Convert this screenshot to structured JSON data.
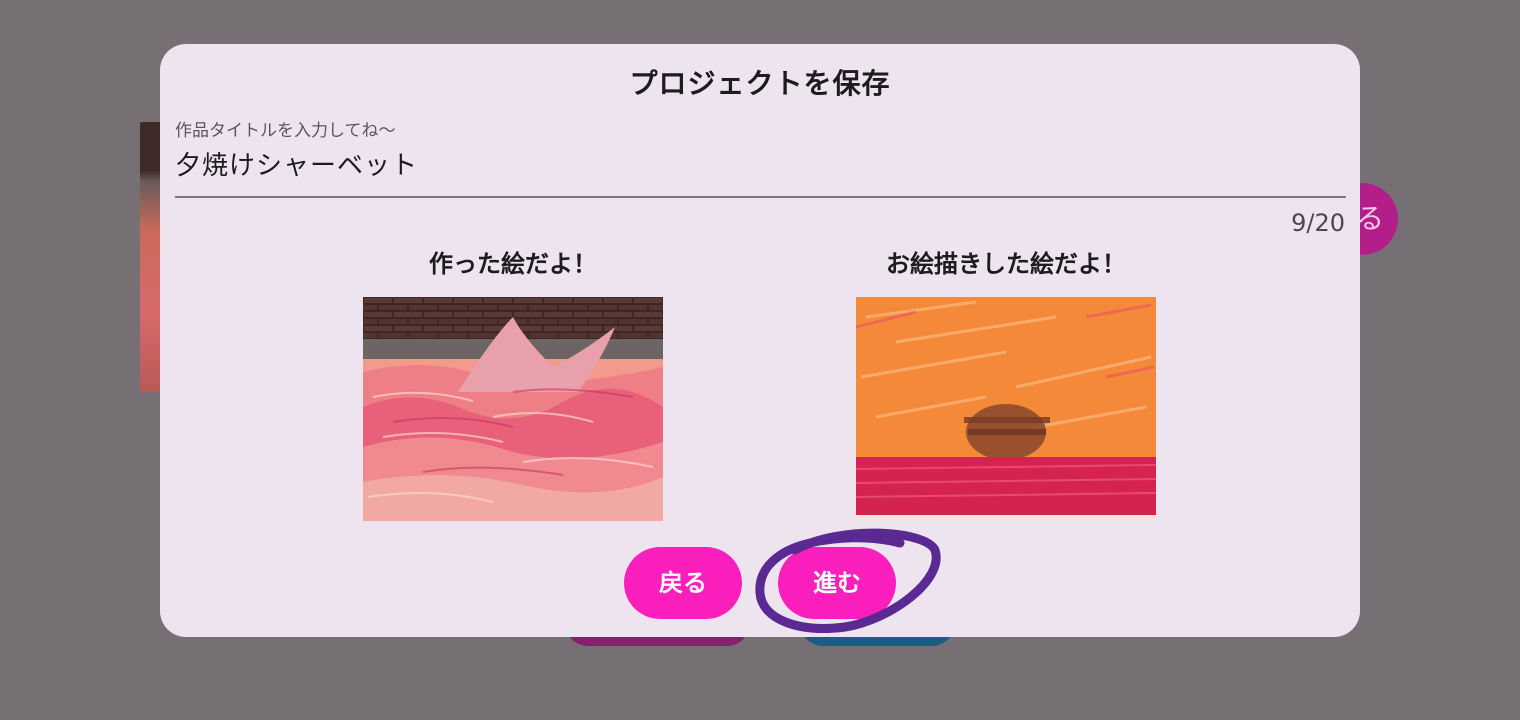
{
  "dialog": {
    "title": "プロジェクトを保存",
    "field": {
      "label": "作品タイトルを入力してね〜",
      "value": "夕焼けシャーベット",
      "counter": "9/20"
    },
    "captions": {
      "made": "作った絵だよ！",
      "drawn": "お絵描きした絵だよ！"
    },
    "buttons": {
      "back": "戻る",
      "next": "進む"
    }
  },
  "background": {
    "circle_button_glyph": "る"
  },
  "colors": {
    "accent": "#fb1fbd",
    "dialog": "#ede4ef",
    "backdrop": "#767074",
    "annotation": "#5a2a92"
  }
}
